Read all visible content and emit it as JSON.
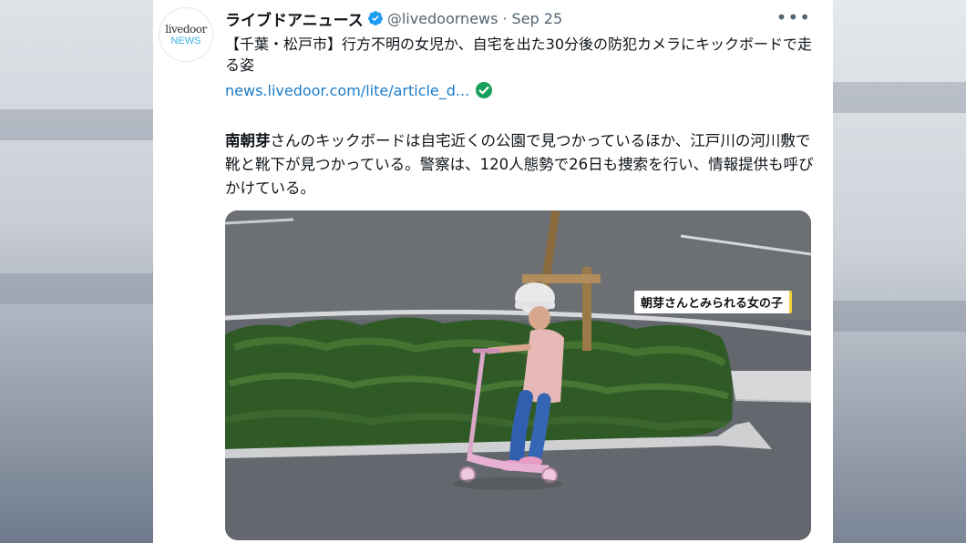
{
  "tweet": {
    "author_name": "ライブドアニュース",
    "handle": "@livedoornews",
    "separator": "·",
    "date": "Sep 25",
    "more_label": "•••",
    "avatar_line1": "livedoor",
    "avatar_line2": "NEWS",
    "headline": "【千葉・松戸市】行方不明の女児か、自宅を出た30分後の防犯カメラにキックボードで走る姿",
    "link_text": "news.livedoor.com/lite/article_d...",
    "para_bold": "南朝芽",
    "para_rest": "さんのキックボードは自宅近くの公園で見つかっているほか、江戸川の河川敷で靴と靴下が見つかっている。警察は、120人態勢で26日も捜索を行い、情報提供も呼びかけている。",
    "image_caption": "朝芽さんとみられる女の子"
  },
  "colors": {
    "accent": "#1d9bf0",
    "link": "#1b7bc8",
    "check_green": "#17a05d",
    "caption_marker": "#f2d23a"
  },
  "icons": {
    "verified": "verified-badge-icon",
    "link_check": "check-circle-icon",
    "more": "more-options-icon"
  }
}
